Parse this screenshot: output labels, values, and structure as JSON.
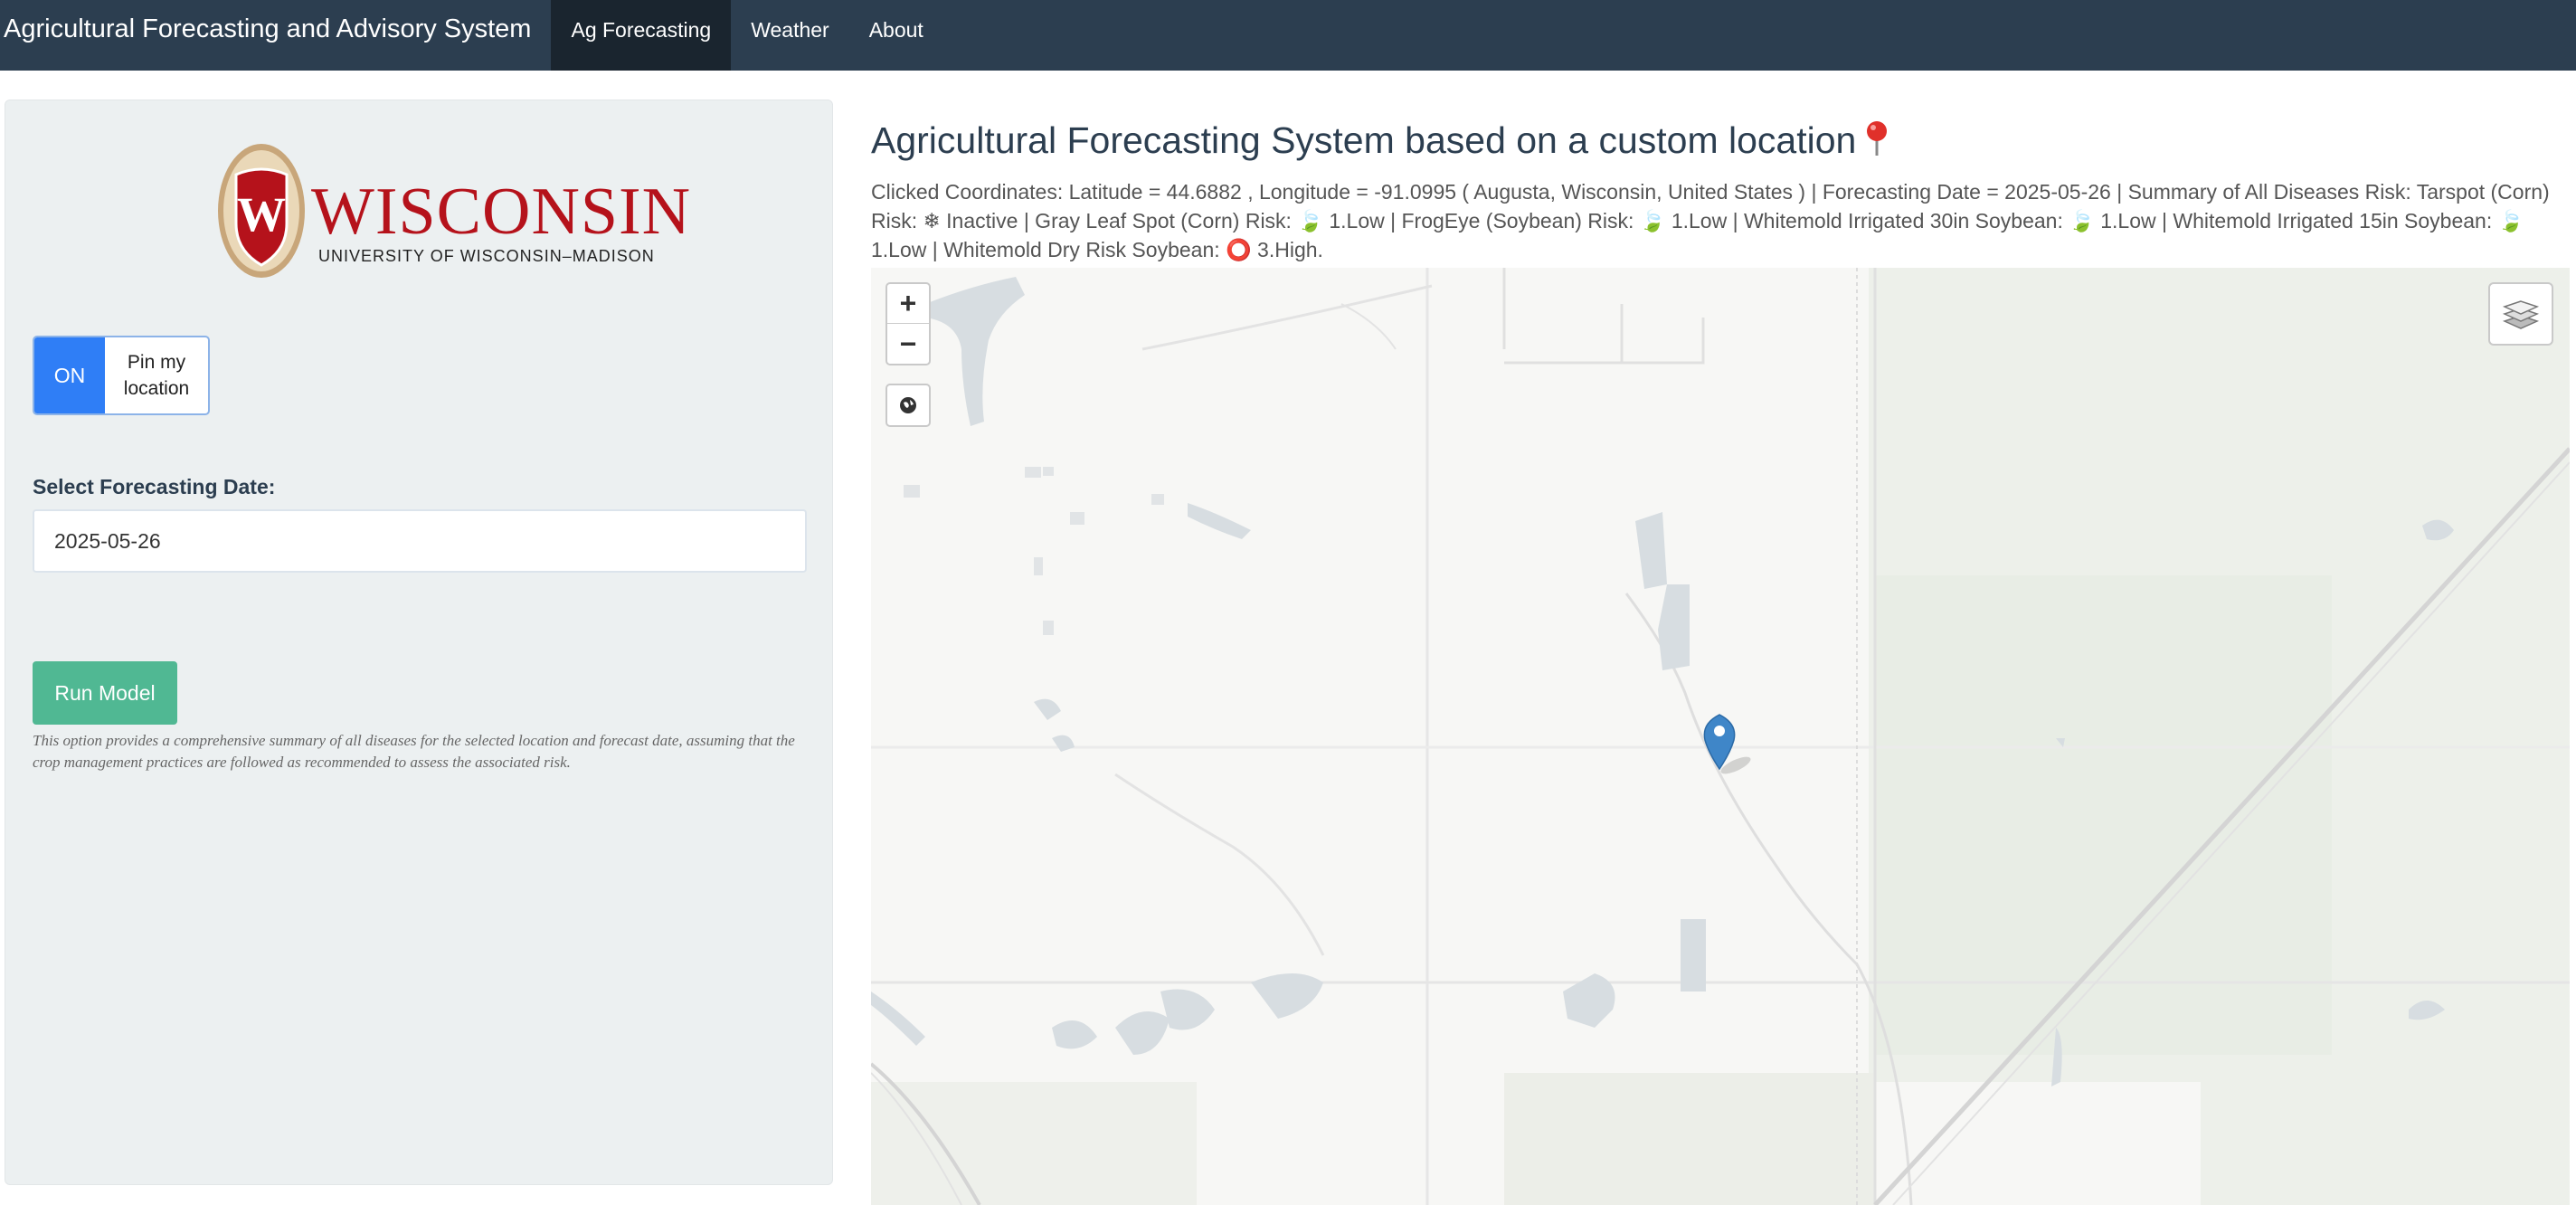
{
  "navbar": {
    "brand": "Agricultural Forecasting and Advisory System",
    "tabs": [
      {
        "label": "Ag Forecasting",
        "active": true
      },
      {
        "label": "Weather",
        "active": false
      },
      {
        "label": "About",
        "active": false
      }
    ]
  },
  "sidebar": {
    "logo": {
      "word": "WISCONSIN",
      "sub": "UNIVERSITY OF WISCONSIN–MADISON"
    },
    "toggle": {
      "state": "ON",
      "label": "Pin my location"
    },
    "date_label": "Select Forecasting Date:",
    "date_value": "2025-05-26",
    "run_button": "Run Model",
    "help_text": "This option provides a comprehensive summary of all diseases for the selected location and forecast date, assuming that the crop management practices are followed as recommended to assess the associated risk."
  },
  "main": {
    "title": "Agricultural Forecasting System based on a custom location",
    "summary": "Clicked Coordinates: Latitude = 44.6882 , Longitude = -91.0995 ( Augusta, Wisconsin, United States ) | Forecasting Date = 2025-05-26 | Summary of All Diseases Risk: Tarspot (Corn) Risk: ❄ Inactive | Gray Leaf Spot (Corn) Risk: 🍃 1.Low | FrogEye (Soybean) Risk: 🍃 1.Low | Whitemold Irrigated 30in Soybean: 🍃 1.Low | Whitemold Irrigated 15in Soybean: 🍃 1.Low | Whitemold Dry Risk Soybean: ⭕ 3.High."
  },
  "map": {
    "zoom_in": "+",
    "zoom_out": "−",
    "icons": [
      "globe-icon",
      "layers-icon",
      "map-marker-icon"
    ]
  },
  "colors": {
    "navbar": "#2c3e50",
    "navbar_active": "#1a252f",
    "toggle_on": "#2f7ef6",
    "run_button": "#50b893",
    "wisconsin_red": "#b5121b",
    "marker": "#3f86c8"
  }
}
